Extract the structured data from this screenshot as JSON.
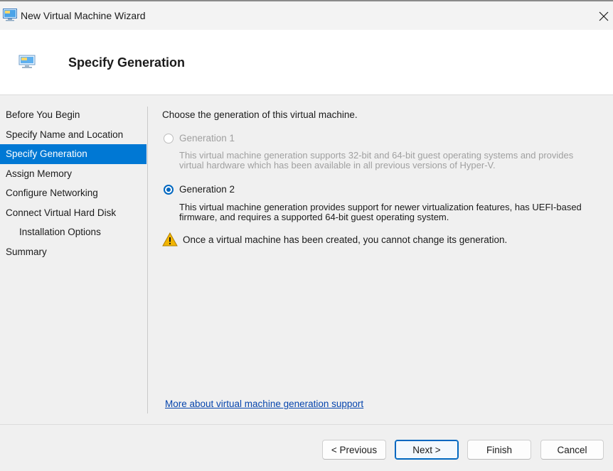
{
  "window": {
    "title": "New Virtual Machine Wizard",
    "icon": "virtual-machine-icon",
    "close_icon": "close-icon"
  },
  "header": {
    "heading": "Specify Generation",
    "icon": "virtual-machine-icon"
  },
  "nav": {
    "items": [
      {
        "label": "Before You Begin",
        "active": false,
        "sub": false
      },
      {
        "label": "Specify Name and Location",
        "active": false,
        "sub": false
      },
      {
        "label": "Specify Generation",
        "active": true,
        "sub": false
      },
      {
        "label": "Assign Memory",
        "active": false,
        "sub": false
      },
      {
        "label": "Configure Networking",
        "active": false,
        "sub": false
      },
      {
        "label": "Connect Virtual Hard Disk",
        "active": false,
        "sub": false
      },
      {
        "label": "Installation Options",
        "active": false,
        "sub": true
      },
      {
        "label": "Summary",
        "active": false,
        "sub": false
      }
    ]
  },
  "main": {
    "prompt": "Choose the generation of this virtual machine.",
    "options": [
      {
        "label": "Generation 1",
        "selected": false,
        "enabled": false,
        "description_line1": "This virtual machine generation supports 32-bit and 64-bit guest operating systems and provides",
        "description_line2": "virtual hardware which has been available in all previous versions of Hyper-V."
      },
      {
        "label": "Generation 2",
        "selected": true,
        "enabled": true,
        "description_line1": "This virtual machine generation provides support for newer virtualization features, has UEFI-based",
        "description_line2": "firmware, and requires a supported 64-bit guest operating system."
      }
    ],
    "warning": {
      "icon": "warning-icon",
      "text": "Once a virtual machine has been created, you cannot change its generation."
    },
    "more_link": "More about virtual machine generation support"
  },
  "buttons": {
    "previous": "< Previous",
    "next": "Next >",
    "finish": "Finish",
    "cancel": "Cancel"
  },
  "colors": {
    "accent": "#0078d4",
    "radio": "#0067c0",
    "link": "#0645ad",
    "warning": "#f2b500"
  }
}
